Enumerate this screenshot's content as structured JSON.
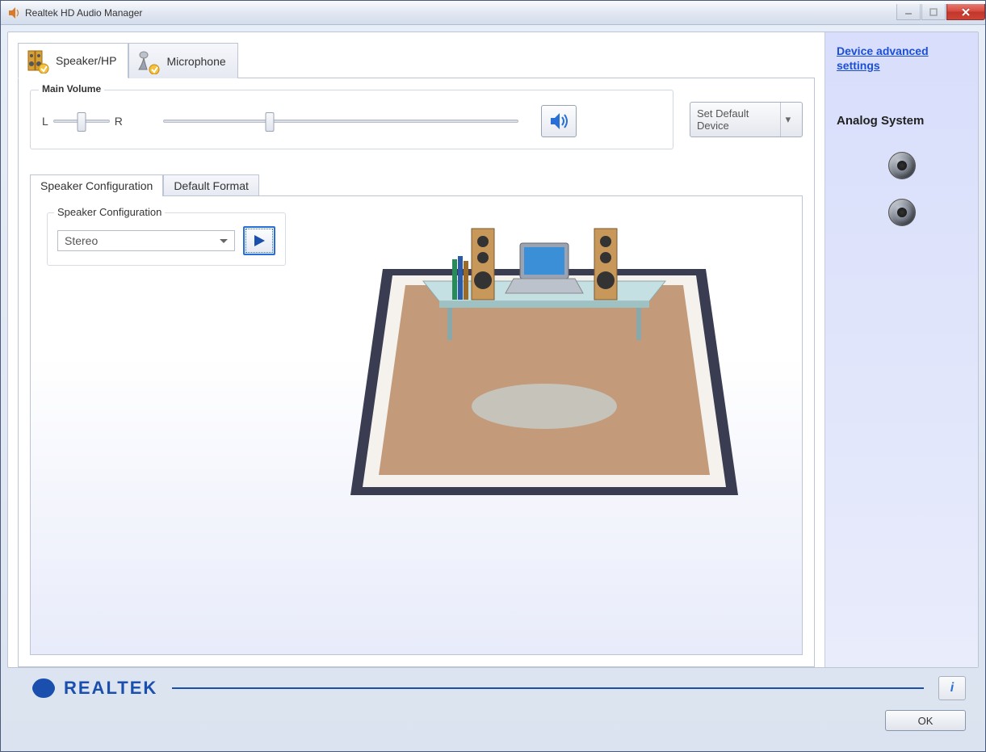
{
  "window": {
    "title": "Realtek HD Audio Manager"
  },
  "device_tabs": {
    "speaker": "Speaker/HP",
    "microphone": "Microphone"
  },
  "main_volume": {
    "group_label": "Main Volume",
    "left_label": "L",
    "right_label": "R",
    "balance_position_pct": 50,
    "volume_position_pct": 30
  },
  "default_device_button": "Set Default Device",
  "config_tabs": {
    "speaker_config": "Speaker Configuration",
    "default_format": "Default Format"
  },
  "speaker_config": {
    "group_label": "Speaker Configuration",
    "selected": "Stereo"
  },
  "side": {
    "advanced_link": "Device advanced settings",
    "analog_title": "Analog System"
  },
  "brand": {
    "name": "REALTEK"
  },
  "footer": {
    "ok": "OK",
    "info": "i"
  }
}
